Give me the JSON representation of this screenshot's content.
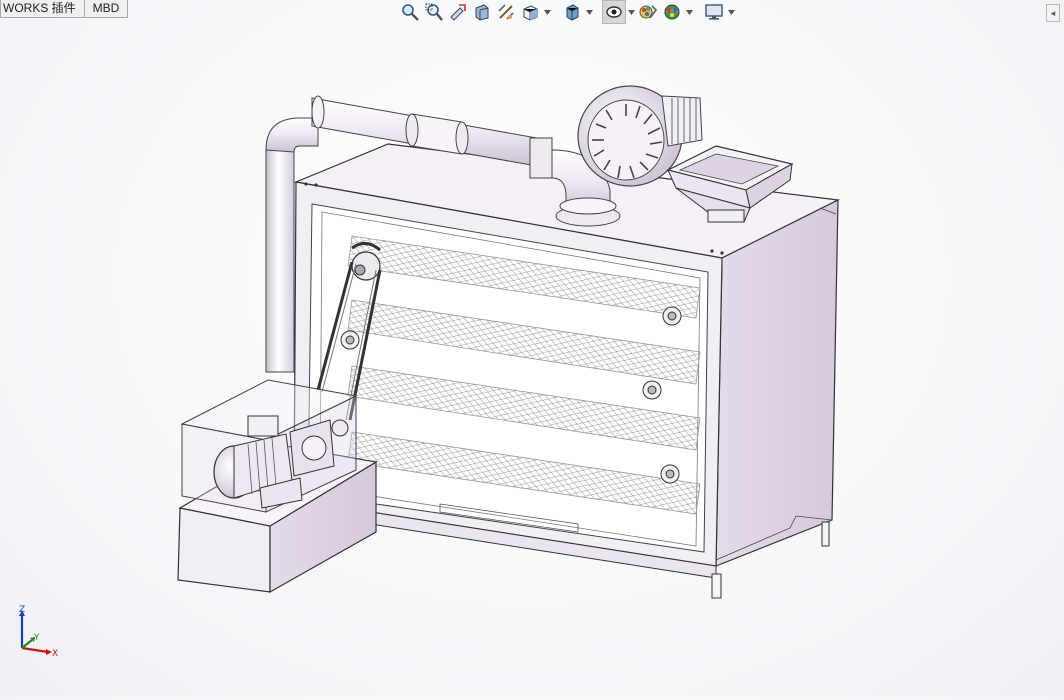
{
  "tabs": [
    {
      "label": "WORKS 插件"
    },
    {
      "label": "MBD"
    }
  ],
  "hud_icons": [
    "zoom-to-fit-icon",
    "zoom-to-area-icon",
    "previous-view-icon",
    "section-view-icon",
    "dynamic-annotation-icon",
    "view-orientation-icon",
    "display-style-icon",
    "hide-show-items-icon",
    "edit-appearance-icon",
    "apply-scene-icon",
    "view-settings-icon"
  ],
  "side_tab": {
    "glyph": "◂"
  },
  "triad": {
    "x": "X",
    "y": "Y",
    "z": "Z"
  },
  "colors": {
    "part_fill": "#ede6f0",
    "part_shade": "#d9cfe0",
    "edge": "#3a3a3a",
    "x_axis": "#d01010",
    "y_axis": "#1c8a1c",
    "z_axis": "#1a3fc8"
  }
}
